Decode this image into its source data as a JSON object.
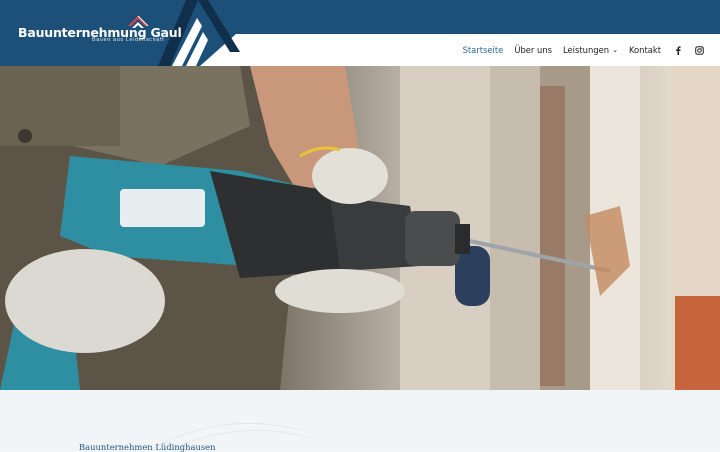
{
  "brand": {
    "name": "Bauunternehmung Gaul",
    "tagline": "Bauen aus Leidenschaft",
    "color": "#1d5078"
  },
  "nav": {
    "items": [
      {
        "label": "Startseite",
        "active": true
      },
      {
        "label": "Über uns",
        "active": false
      },
      {
        "label": "Leistungen",
        "active": false,
        "dropdown": true
      },
      {
        "label": "Kontakt",
        "active": false
      }
    ],
    "social": [
      "facebook-icon",
      "instagram-icon"
    ]
  },
  "hero": {
    "image": "worker-drilling-wall-photo"
  },
  "intro": {
    "heading": "Bauunternehmen Lüdinghausen"
  }
}
